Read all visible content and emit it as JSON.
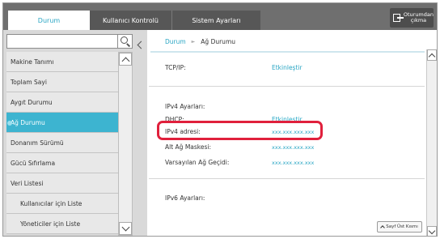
{
  "tabs": [
    {
      "label": "Durum"
    },
    {
      "label": "Kullanıcı Kontrolü"
    },
    {
      "label": "Sistem Ayarları"
    }
  ],
  "logout": {
    "label_line1": "Oturumdan",
    "label_line2": "çıkma",
    "icon": "logout-icon"
  },
  "search": {
    "placeholder": "",
    "icon": "search-icon"
  },
  "sidebar": {
    "items": [
      {
        "label": "Makine Tanımı"
      },
      {
        "label": "Toplam Sayi"
      },
      {
        "label": "Aygıt Durumu"
      },
      {
        "label": "Ağ Durumu"
      },
      {
        "label": "Donanım Sürümü"
      },
      {
        "label": "Gücü Sıfırlama"
      },
      {
        "label": "Veri Listesi"
      },
      {
        "label": "Kullanıcılar için Liste"
      },
      {
        "label": "Yöneticiler için Liste"
      }
    ]
  },
  "breadcrumb": {
    "parent": "Durum",
    "separator": "►",
    "current": "Ağ Durumu"
  },
  "content": {
    "tcpip_label": "TCP/IP:",
    "tcpip_value": "Etkinleştir",
    "ipv4_heading": "IPv4 Ayarları:",
    "dhcp_label": "DHCP:",
    "dhcp_value": "Etkinleştir",
    "ipv4_address_label": "IPv4 adresi:",
    "ipv4_address_value": "xxx.xxx.xxx.xxx",
    "subnet_label": "Alt Ağ Maskesi:",
    "subnet_value": "xxx.xxx.xxx.xxx",
    "gateway_label": "Varsayılan Ağ Geçidi:",
    "gateway_value": "xxx.xxx.xxx.xxx",
    "ipv6_heading": "IPv6 Ayarları:"
  },
  "page_top_button": "Sayf Üst Kısmı",
  "colors": {
    "accent": "#2aa6c4",
    "active_menu": "#3db4d0",
    "highlight": "#e0203c",
    "topbar": "#6f6f6f"
  }
}
